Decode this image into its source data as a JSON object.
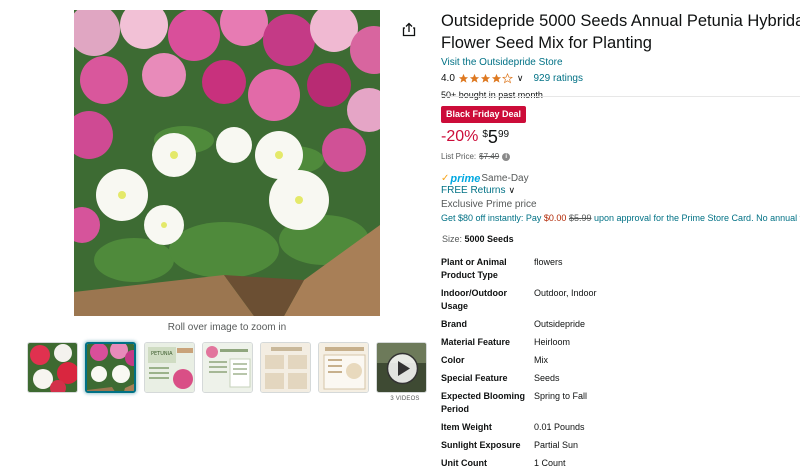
{
  "gallery": {
    "zoom_hint": "Roll over image to zoom in",
    "video_count": "3 VIDEOS",
    "thumbnails": [
      "red-white-petunias",
      "petunia-planter",
      "seed-packet-front",
      "seed-packet-back",
      "planting-guide",
      "growing-chart",
      "video-thumbnail"
    ],
    "selected_index": 1
  },
  "product": {
    "title": "Outsidepride 5000 Seeds Annual Petunia Hybrida",
    "title_line2": "Flower Seed Mix for Planting",
    "store_link": "Visit the Outsidepride Store",
    "rating": "4.0",
    "rating_value": 4.0,
    "ratings_count": "929 ratings",
    "bought": "50+ bought in past month"
  },
  "pricing": {
    "deal_badge": "Black Friday Deal",
    "discount": "-20%",
    "currency": "$",
    "price_whole": "5",
    "price_fraction": "99",
    "list_price_label": "List Price:",
    "list_price": "$7.49",
    "info_icon": "i"
  },
  "delivery": {
    "prime_check": "✓",
    "prime_label": "prime",
    "same_day": "Same-Day",
    "free_returns": "FREE Returns",
    "exclusive": "Exclusive Prime price",
    "card_offer_prefix": "Get $80 off instantly: Pay ",
    "card_offer_new": "$0.00",
    "card_offer_old": "$5.99",
    "card_offer_suffix": " upon approval for the Prime Store Card. No annual fee"
  },
  "size": {
    "label": "Size:",
    "value": "5000 Seeds"
  },
  "specs": [
    {
      "key": "Plant or Animal Product Type",
      "value": "flowers"
    },
    {
      "key": "Indoor/Outdoor Usage",
      "value": "Outdoor, Indoor"
    },
    {
      "key": "Brand",
      "value": "Outsidepride"
    },
    {
      "key": "Material Feature",
      "value": "Heirloom"
    },
    {
      "key": "Color",
      "value": "Mix"
    },
    {
      "key": "Special Feature",
      "value": "Seeds"
    },
    {
      "key": "Expected Blooming Period",
      "value": "Spring to Fall"
    },
    {
      "key": "Item Weight",
      "value": "0.01 Pounds"
    },
    {
      "key": "Sunlight Exposure",
      "value": "Partial Sun"
    },
    {
      "key": "Unit Count",
      "value": "1 Count"
    }
  ],
  "colors": {
    "link": "#007185",
    "deal_red": "#cc0c39",
    "star": "#de7921",
    "prime_blue": "#00a8e1"
  },
  "icons": {
    "share": "share-icon",
    "chevron": "chevron-down-icon",
    "play": "play-icon"
  }
}
